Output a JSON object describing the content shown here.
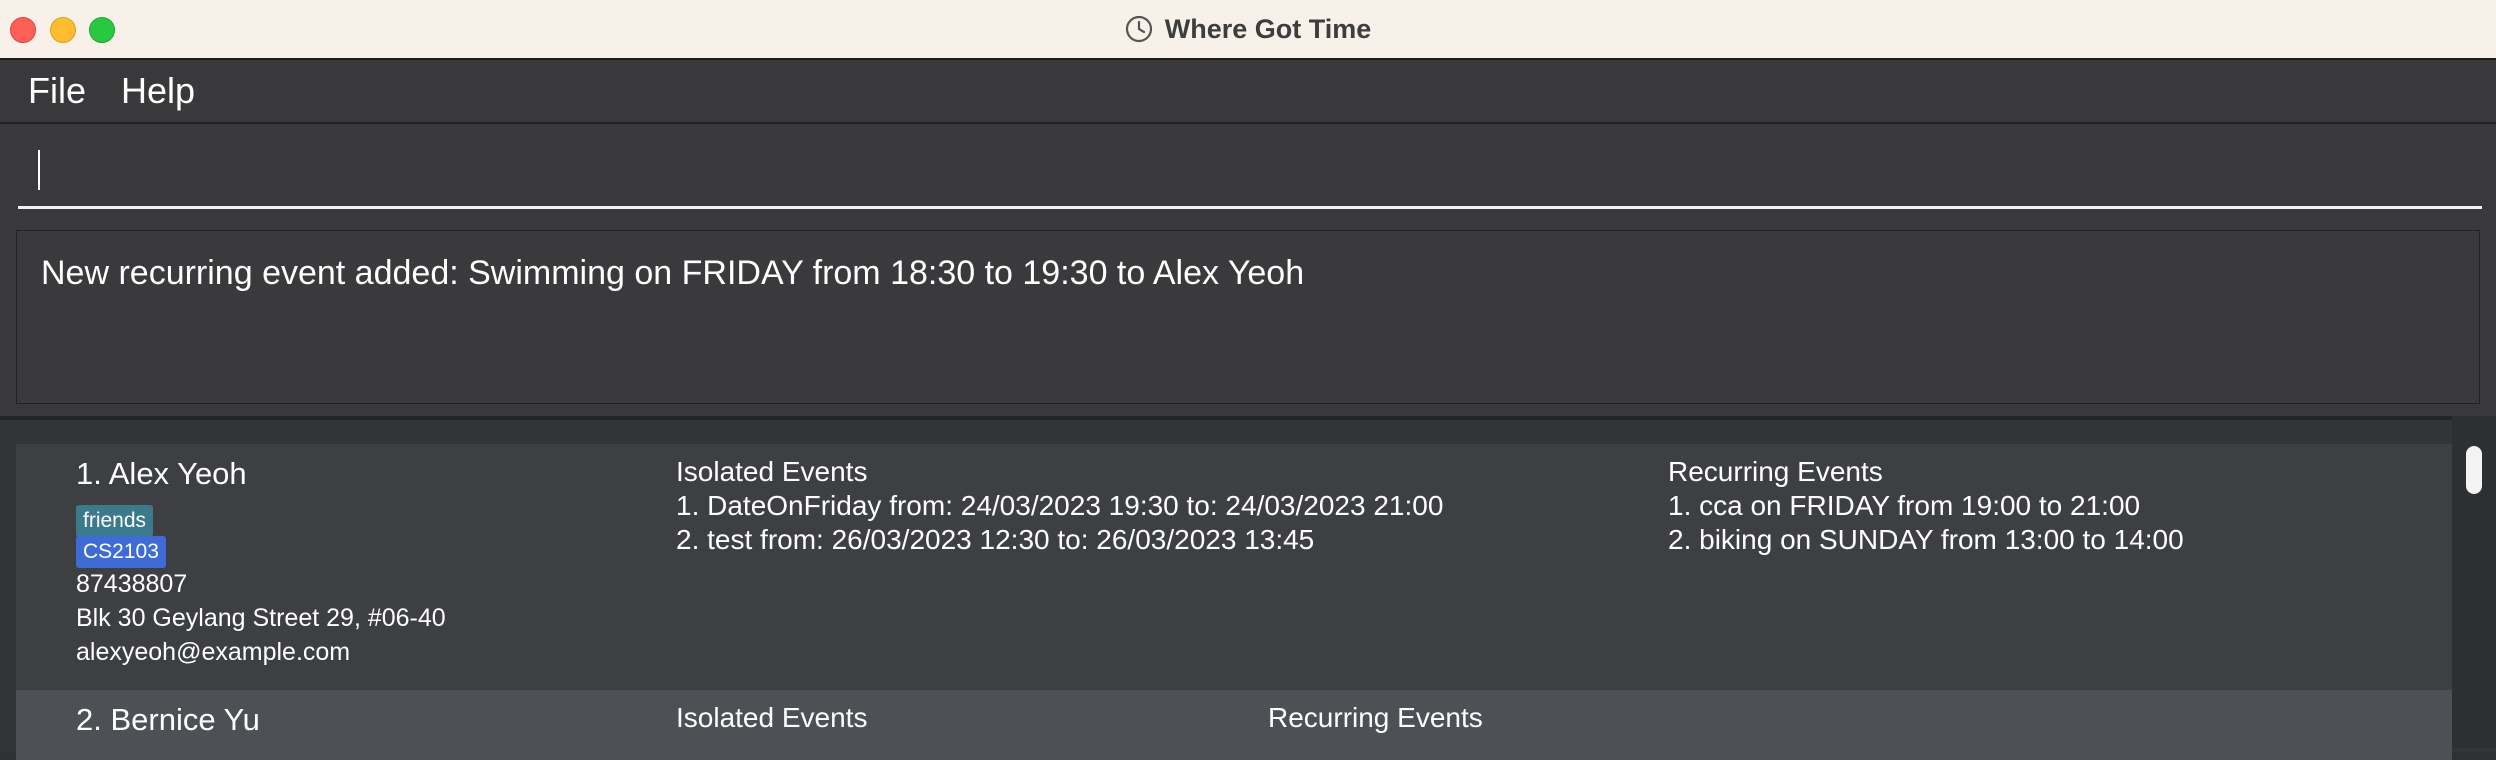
{
  "window": {
    "title": "Where Got Time",
    "icon": "clock-icon"
  },
  "menu": {
    "file": "File",
    "help": "Help"
  },
  "command": {
    "value": ""
  },
  "result": {
    "message": "New recurring event added: Swimming on FRIDAY from 18:30 to 19:30 to Alex Yeoh"
  },
  "persons": [
    {
      "name": "1. Alex Yeoh",
      "tags": [
        "friends",
        "CS2103"
      ],
      "phone": "87438807",
      "address": "Blk 30 Geylang Street 29, #06-40",
      "email": "alexyeoh@example.com",
      "isolated_header": "Isolated Events",
      "isolated": [
        "1. DateOnFriday from: 24/03/2023 19:30 to: 24/03/2023 21:00",
        "2. test from: 26/03/2023 12:30 to: 26/03/2023 13:45"
      ],
      "recurring_header": "Recurring Events",
      "recurring": [
        "1. cca on FRIDAY from 19:00 to 21:00",
        "2. biking on SUNDAY from 13:00 to 14:00"
      ]
    },
    {
      "name": "2. Bernice Yu",
      "isolated_header": "Isolated Events",
      "recurring_header": "Recurring Events"
    }
  ],
  "colors": {
    "titlebar": "#f7f1ea",
    "tag_friends": "#3b7a8c",
    "tag_cs": "#3e6bd6",
    "selected_card": "#4d5155"
  }
}
